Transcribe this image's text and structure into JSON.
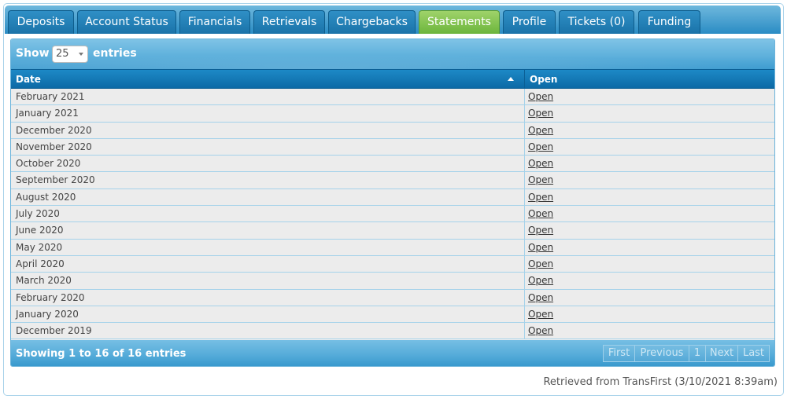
{
  "tabs": [
    {
      "label": "Deposits",
      "active": false
    },
    {
      "label": "Account Status",
      "active": false
    },
    {
      "label": "Financials",
      "active": false
    },
    {
      "label": "Retrievals",
      "active": false
    },
    {
      "label": "Chargebacks",
      "active": false
    },
    {
      "label": "Statements",
      "active": true
    },
    {
      "label": "Profile",
      "active": false
    },
    {
      "label": "Tickets (0)",
      "active": false
    },
    {
      "label": "Funding",
      "active": false
    }
  ],
  "length": {
    "show_label": "Show",
    "value": "25",
    "entries_label": "entries"
  },
  "table": {
    "columns": [
      "Date",
      "Open"
    ],
    "rows": [
      {
        "date": "February 2021",
        "open": "Open"
      },
      {
        "date": "January 2021",
        "open": "Open"
      },
      {
        "date": "December 2020",
        "open": "Open"
      },
      {
        "date": "November 2020",
        "open": "Open"
      },
      {
        "date": "October 2020",
        "open": "Open"
      },
      {
        "date": "September 2020",
        "open": "Open"
      },
      {
        "date": "August 2020",
        "open": "Open"
      },
      {
        "date": "July 2020",
        "open": "Open"
      },
      {
        "date": "June 2020",
        "open": "Open"
      },
      {
        "date": "May 2020",
        "open": "Open"
      },
      {
        "date": "April 2020",
        "open": "Open"
      },
      {
        "date": "March 2020",
        "open": "Open"
      },
      {
        "date": "February 2020",
        "open": "Open"
      },
      {
        "date": "January 2020",
        "open": "Open"
      },
      {
        "date": "December 2019",
        "open": "Open"
      }
    ]
  },
  "info": "Showing 1 to 16 of 16 entries",
  "pager": [
    "First",
    "Previous",
    "1",
    "Next",
    "Last"
  ],
  "footer_note": "Retrieved from TransFirst (3/10/2021 8:39am)",
  "colors": {
    "active_tab": "#7cc04a",
    "tab": "#1f7fb8",
    "header": "#1379b5"
  }
}
